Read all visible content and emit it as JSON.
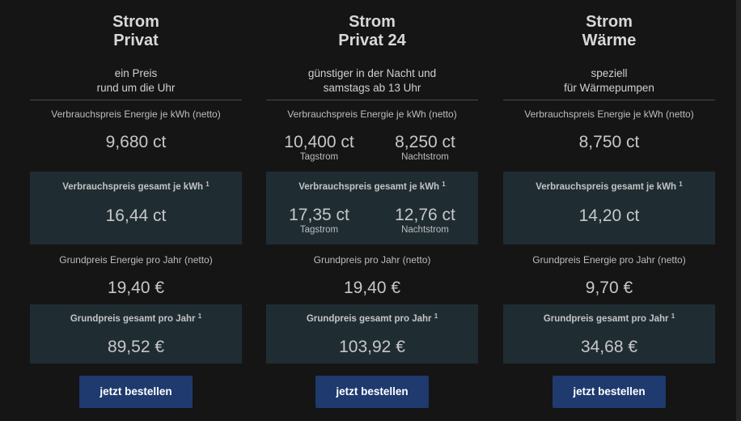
{
  "tariffs": [
    {
      "title_line1": "Strom",
      "title_line2": "Privat",
      "subtitle_line1": "ein Preis",
      "subtitle_line2": "rund um die Uhr",
      "energy_label": "Verbrauchspreis Energie je kWh (netto)",
      "energy_value": "9,680 ct",
      "total_kwh_label": "Verbrauchspreis gesamt je kWh",
      "total_kwh_footnote": "1",
      "total_kwh_value": "16,44 ct",
      "base_label": "Grundpreis Energie pro Jahr (netto)",
      "base_value": "19,40 €",
      "total_year_label": "Grundpreis gesamt pro Jahr",
      "total_year_footnote": "1",
      "total_year_value": "89,52 €",
      "button_label": "jetzt bestellen"
    },
    {
      "title_line1": "Strom",
      "title_line2": "Privat 24",
      "subtitle_line1": "günstiger in der Nacht und",
      "subtitle_line2": "samstags ab 13 Uhr",
      "energy_label": "Verbrauchspreis Energie je kWh (netto)",
      "energy_day_value": "10,400 ct",
      "energy_day_label": "Tagstrom",
      "energy_night_value": "8,250 ct",
      "energy_night_label": "Nachtstrom",
      "total_kwh_label": "Verbrauchspreis gesamt je kWh",
      "total_kwh_footnote": "1",
      "total_day_value": "17,35 ct",
      "total_day_label": "Tagstrom",
      "total_night_value": "12,76 ct",
      "total_night_label": "Nachtstrom",
      "base_label": "Grundpreis pro Jahr (netto)",
      "base_value": "19,40 €",
      "total_year_label": "Grundpreis gesamt pro Jahr",
      "total_year_footnote": "1",
      "total_year_value": "103,92 €",
      "button_label": "jetzt bestellen"
    },
    {
      "title_line1": "Strom",
      "title_line2": "Wärme",
      "subtitle_line1": "speziell",
      "subtitle_line2": "für Wärmepumpen",
      "energy_label": "Verbrauchspreis Energie je kWh (netto)",
      "energy_value": "8,750 ct",
      "total_kwh_label": "Verbrauchspreis gesamt je kWh",
      "total_kwh_footnote": "1",
      "total_kwh_value": "14,20 ct",
      "base_label": "Grundpreis Energie pro Jahr (netto)",
      "base_value": "9,70 €",
      "total_year_label": "Grundpreis gesamt pro Jahr",
      "total_year_footnote": "1",
      "total_year_value": "34,68 €",
      "button_label": "jetzt bestellen"
    }
  ],
  "colors": {
    "background": "#151515",
    "highlight_box": "#1f2d33",
    "button": "#1e3a6e",
    "button_text": "#ffffff"
  }
}
